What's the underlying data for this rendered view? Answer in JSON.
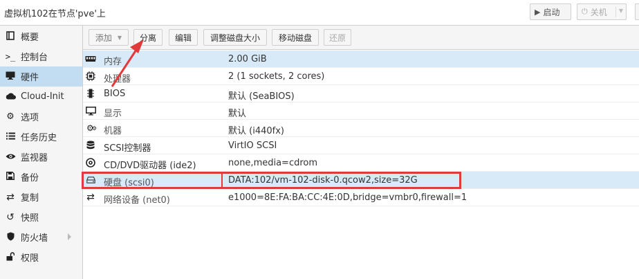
{
  "header": {
    "title": "虚拟机102在节点'pve'上",
    "start_label": "启动",
    "shutdown_label": "关机"
  },
  "sidebar": {
    "items": [
      {
        "label": "概要",
        "icon": "book-icon"
      },
      {
        "label": "控制台",
        "icon": "terminal-icon"
      },
      {
        "label": "硬件",
        "icon": "monitor-icon",
        "active": true
      },
      {
        "label": "Cloud-Init",
        "icon": "cloud-icon"
      },
      {
        "label": "选项",
        "icon": "gear-icon"
      },
      {
        "label": "任务历史",
        "icon": "list-icon"
      },
      {
        "label": "监视器",
        "icon": "eye-icon"
      },
      {
        "label": "备份",
        "icon": "floppy-icon"
      },
      {
        "label": "复制",
        "icon": "retweet-icon"
      },
      {
        "label": "快照",
        "icon": "history-icon"
      },
      {
        "label": "防火墙",
        "icon": "shield-icon"
      },
      {
        "label": "权限",
        "icon": "unlock-icon"
      }
    ]
  },
  "toolbar": {
    "add_label": "添加",
    "detach_label": "分离",
    "edit_label": "编辑",
    "resize_label": "调整磁盘大小",
    "move_label": "移动磁盘",
    "revert_label": "还原"
  },
  "hardware": {
    "rows": [
      {
        "key": "内存",
        "value": "2.00 GiB",
        "icon": "memory-icon"
      },
      {
        "key": "处理器",
        "value": "2 (1 sockets, 2 cores)",
        "icon": "cpu-icon"
      },
      {
        "key": "BIOS",
        "value": "默认 (SeaBIOS)",
        "icon": "microchip-icon"
      },
      {
        "key": "显示",
        "value": "默认",
        "icon": "desktop-icon"
      },
      {
        "key": "机器",
        "value": "默认 (i440fx)",
        "icon": "cogs-icon"
      },
      {
        "key": "SCSI控制器",
        "value": "VirtIO SCSI",
        "icon": "database-icon"
      },
      {
        "key": "CD/DVD驱动器 (ide2)",
        "value": "none,media=cdrom",
        "icon": "cdrom-icon"
      },
      {
        "key": "硬盘 (scsi0)",
        "value": "DATA:102/vm-102-disk-0.qcow2,size=32G",
        "icon": "hdd-icon"
      },
      {
        "key": "网络设备 (net0)",
        "value": "e1000=8E:FA:BA:CC:4E:0D,bridge=vmbr0,firewall=1",
        "icon": "exchange-icon"
      }
    ]
  },
  "colors": {
    "accent": "#c2dcf2",
    "highlight": "#e03a3a"
  }
}
